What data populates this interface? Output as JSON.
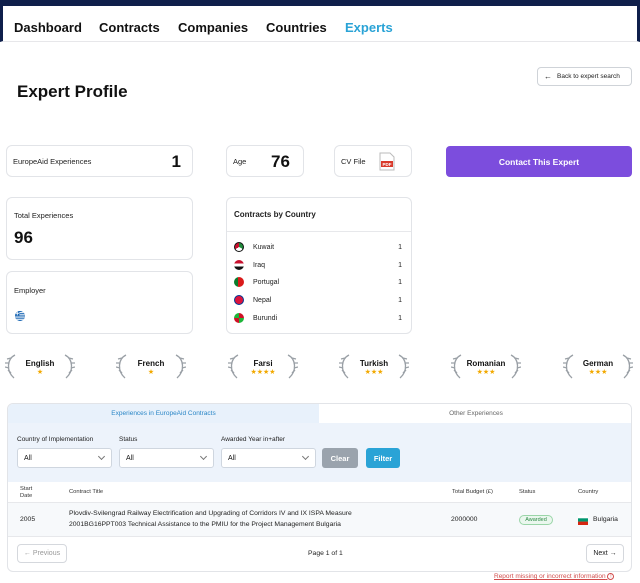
{
  "nav": {
    "items": [
      "Dashboard",
      "Contracts",
      "Companies",
      "Countries",
      "Experts"
    ],
    "active": "Experts"
  },
  "page_title": "Expert Profile",
  "back_button": "Back to expert search",
  "stats": {
    "europeaid_label": "EuropeAid Experiences",
    "europeaid_value": "1",
    "age_label": "Age",
    "age_value": "76",
    "cv_label": "CV File",
    "cv_icon": "pdf-file-icon",
    "total_label": "Total Experiences",
    "total_value": "96",
    "employer_label": "Employer",
    "employer_flag": "greece-flag-icon"
  },
  "contact_button": "Contact This Expert",
  "contracts_by_country": {
    "title": "Contracts by Country",
    "rows": [
      {
        "country": "Kuwait",
        "count": "1",
        "color": "#1f8a3b"
      },
      {
        "country": "Iraq",
        "count": "1",
        "color": "#c8102e"
      },
      {
        "country": "Portugal",
        "count": "1",
        "color": "#0a7d2c"
      },
      {
        "country": "Nepal",
        "count": "1",
        "color": "#dc143c"
      },
      {
        "country": "Burundi",
        "count": "1",
        "color": "#cf1126"
      }
    ]
  },
  "languages": [
    {
      "name": "English",
      "stars": "★"
    },
    {
      "name": "French",
      "stars": "★"
    },
    {
      "name": "Farsi",
      "stars": "★★★★"
    },
    {
      "name": "Turkish",
      "stars": "★★★"
    },
    {
      "name": "Romanian",
      "stars": "★★★"
    },
    {
      "name": "German",
      "stars": "★★★"
    }
  ],
  "experiences": {
    "tabs": [
      "Experiences in EuropeAid Contracts",
      "Other Experiences"
    ],
    "filters": {
      "country_label": "Country of Implementation",
      "country_value": "All",
      "status_label": "Status",
      "status_value": "All",
      "year_label": "Awarded Year in+after",
      "year_value": "All",
      "clear": "Clear",
      "filter": "Filter"
    },
    "columns": {
      "start_date": "Start Date",
      "contract_title": "Contract Title",
      "budget": "Total Budget (£)",
      "status": "Status",
      "country": "Country"
    },
    "rows": [
      {
        "start_date": "2005",
        "title_line1": "Plovdiv-Svilengrad Railway Electrification and Upgrading of Corridors IV and IX ISPA Measure",
        "title_line2": "2001BG16PPT003 Technical Assistance to the PMIU for the Project Management Bulgaria",
        "budget": "2000000",
        "status": "Awarded",
        "country": "Bulgaria"
      }
    ],
    "pagination": {
      "previous": "← Previous",
      "page_info": "Page 1 of 1",
      "next": "Next →"
    }
  },
  "report_link": "Report missing or incorrect information"
}
